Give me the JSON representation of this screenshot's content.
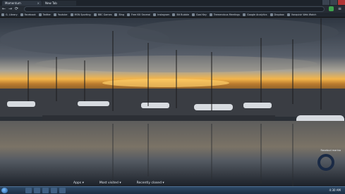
{
  "browser": {
    "active_tab": {
      "title": "Momentum",
      "close": "×"
    },
    "inactive_tab": {
      "title": "New Tab"
    },
    "address": {
      "placeholder": "",
      "nav": {
        "back": "←",
        "forward": "→",
        "reload": "⟳"
      }
    },
    "bookmarks": [
      "G. Library",
      "Facebook",
      "Twitter",
      "Youtube",
      "MSN Sporting",
      "BBC Games",
      "Bing",
      "Free Kill Several",
      "Instagram",
      "Bit Bubble",
      "Goal Key",
      "Tremendous Meetings",
      "Google Analytics",
      "Dropbox",
      "Vanquish Web Watch"
    ]
  },
  "wallpaper": {
    "credit": "Rosebud marina",
    "bottom_links": [
      "Apps ▾",
      "Most visited ▾",
      "Recently closed ▾"
    ]
  },
  "taskbar": {
    "clock": "4:30 AM",
    "icons": [
      "folder",
      "browser",
      "mail",
      "media",
      "chrome"
    ]
  }
}
